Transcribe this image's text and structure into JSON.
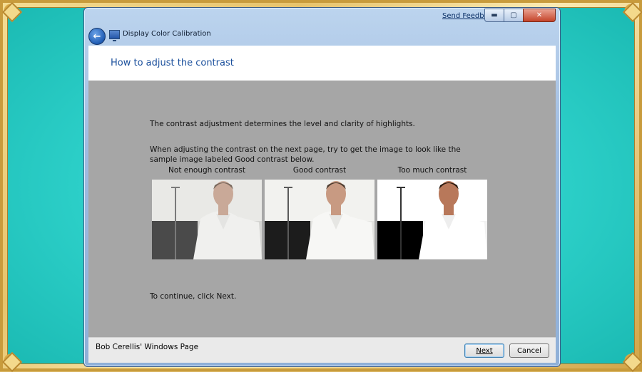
{
  "window": {
    "title": "Display Color Calibration",
    "send_feedback": "Send Feedback",
    "controls": {
      "minimize": "▬",
      "maximize": "▢",
      "close": "✕"
    }
  },
  "header": {
    "title": "How to adjust the contrast"
  },
  "content": {
    "intro": "The contrast adjustment determines the level and clarity of highlights.",
    "instruction": "When adjusting the contrast on the next page, try to get the image to look like the sample image labeled Good contrast below.",
    "samples": [
      {
        "caption": "Not enough contrast",
        "level": "low"
      },
      {
        "caption": "Good contrast",
        "level": "good"
      },
      {
        "caption": "Too much contrast",
        "level": "high"
      }
    ],
    "continue": "To continue, click Next."
  },
  "footer": {
    "text": "Bob Cerellis' Windows Page",
    "next": "Next",
    "cancel": "Cancel"
  },
  "colors": {
    "teal": "#2fd3cc",
    "gold": "#d9b560",
    "header_blue": "#1a4f9c",
    "gray": "#a6a6a6"
  },
  "icons": {
    "back": "back-arrow-icon",
    "app": "display-icon"
  }
}
